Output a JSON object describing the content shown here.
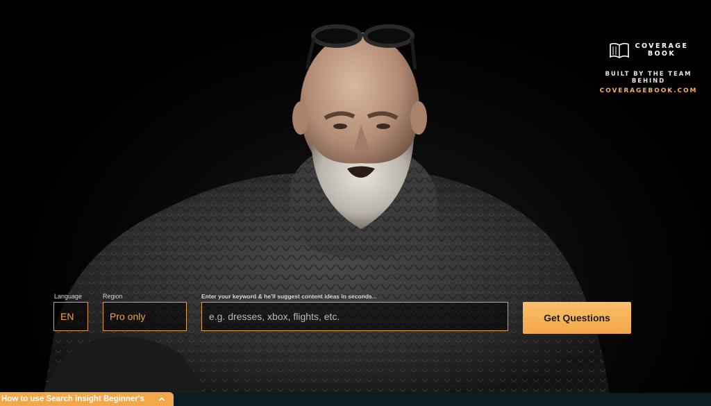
{
  "brand": {
    "name_line1": "COVERAGE",
    "name_line2": "BOOK",
    "built_by": "BUILT BY THE TEAM BEHIND",
    "link": "COVERAGEBOOK.COM",
    "logo_icon": "open-book-icon"
  },
  "search": {
    "language_label": "Language",
    "language_value": "EN",
    "region_label": "Region",
    "region_value": "Pro only",
    "keyword_label": "Enter your keyword & he'll suggest content ideas in seconds...",
    "keyword_placeholder": "e.g. dresses, xbox, flights, etc.",
    "submit_label": "Get Questions"
  },
  "help_tab": {
    "label": "How to use Search insight Beginner's",
    "icon": "chevron-up-icon"
  },
  "colors": {
    "accent": "#f2a748",
    "link": "#f2b25b",
    "background": "#000000",
    "footer": "#0a1b22"
  }
}
